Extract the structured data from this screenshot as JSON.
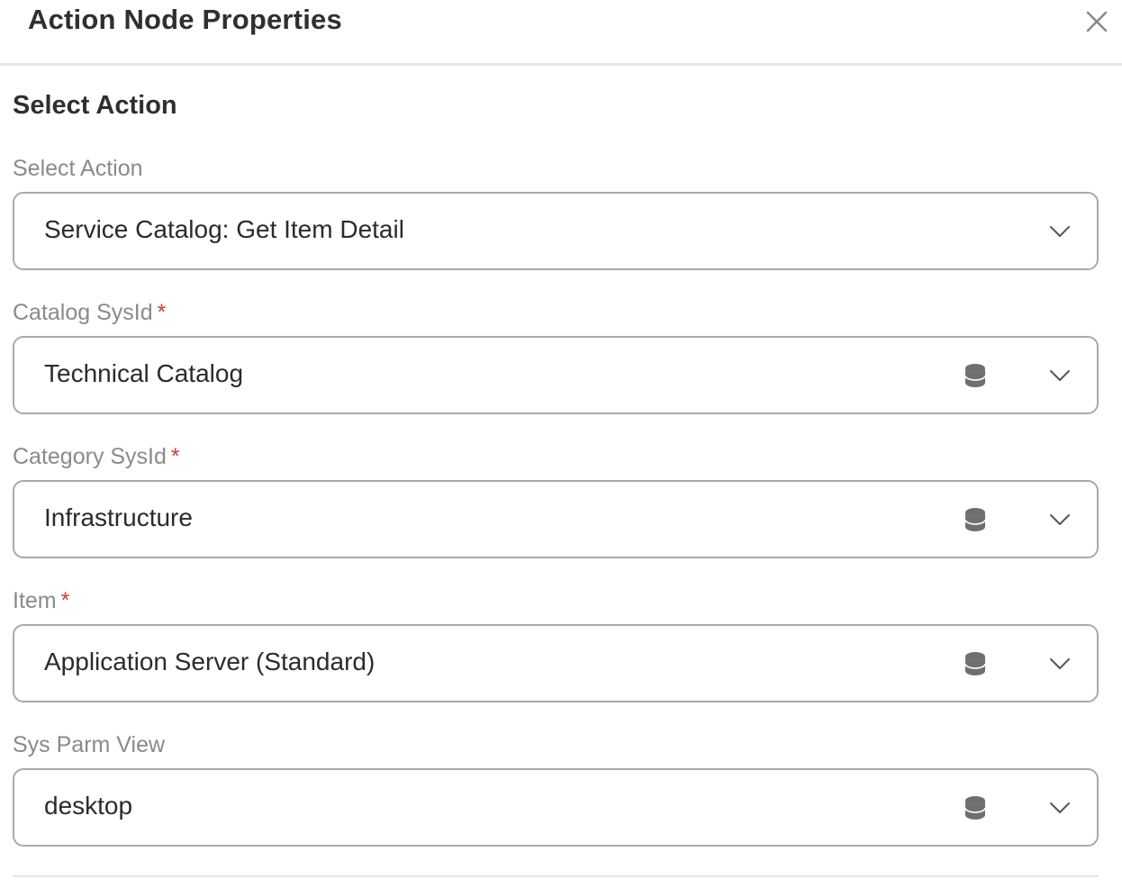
{
  "panel": {
    "title": "Action Node Properties",
    "close_icon": "close-icon"
  },
  "section": {
    "title": "Select Action"
  },
  "fields": [
    {
      "label": "Select Action",
      "required": false,
      "value": "Service Catalog: Get Item Detail",
      "has_data_icon": false
    },
    {
      "label": "Catalog SysId",
      "required": true,
      "required_mark": "*",
      "value": "Technical Catalog",
      "has_data_icon": true
    },
    {
      "label": "Category SysId",
      "required": true,
      "required_mark": "*",
      "value": "Infrastructure",
      "has_data_icon": true
    },
    {
      "label": "Item",
      "required": true,
      "required_mark": "*",
      "value": "Application Server (Standard)",
      "has_data_icon": true
    },
    {
      "label": "Sys Parm View",
      "required": false,
      "value": "desktop",
      "has_data_icon": true
    }
  ],
  "icons": {
    "data_source": "database-icon",
    "dropdown": "chevron-down-icon"
  },
  "colors": {
    "required": "#d9363e",
    "border": "#a9a9a9",
    "label": "#8a8a8a",
    "divider": "#e6e6e6"
  }
}
